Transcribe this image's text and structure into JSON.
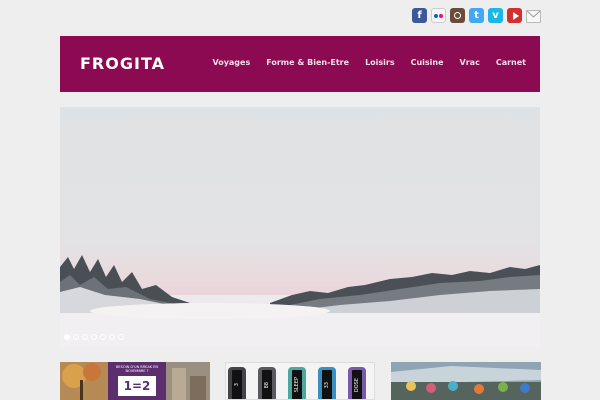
{
  "social": {
    "icons": [
      "facebook-icon",
      "flickr-icon",
      "instagram-icon",
      "twitter-icon",
      "vimeo-icon",
      "youtube-icon",
      "mail-icon"
    ],
    "facebook_glyph": "f",
    "twitter_glyph": "t",
    "vimeo_glyph": "v"
  },
  "header": {
    "logo": "FROGITA",
    "background_color": "#8b0a51"
  },
  "nav": {
    "items": [
      {
        "label": "Voyages"
      },
      {
        "label": "Forme & Bien-Etre"
      },
      {
        "label": "Loisirs"
      },
      {
        "label": "Cuisine"
      },
      {
        "label": "Vrac"
      },
      {
        "label": "Carnet"
      }
    ]
  },
  "slider": {
    "dots_count": 7,
    "active_dot": 1
  },
  "thumbnails": {
    "first": {
      "promo_text": "BESOIN D'UN BREAK EN NOVEMBRE ?",
      "promo_offer": "1=2"
    },
    "second": {
      "bands": [
        {
          "screen": "3",
          "color": "#444448"
        },
        {
          "screen": "88",
          "color": "#5a5a5e"
        },
        {
          "screen": "SLEEP",
          "color": "#4aa8a0"
        },
        {
          "screen": "33",
          "color": "#3a8fc0"
        },
        {
          "screen": "DOSE",
          "color": "#7a5aa8"
        }
      ]
    }
  }
}
